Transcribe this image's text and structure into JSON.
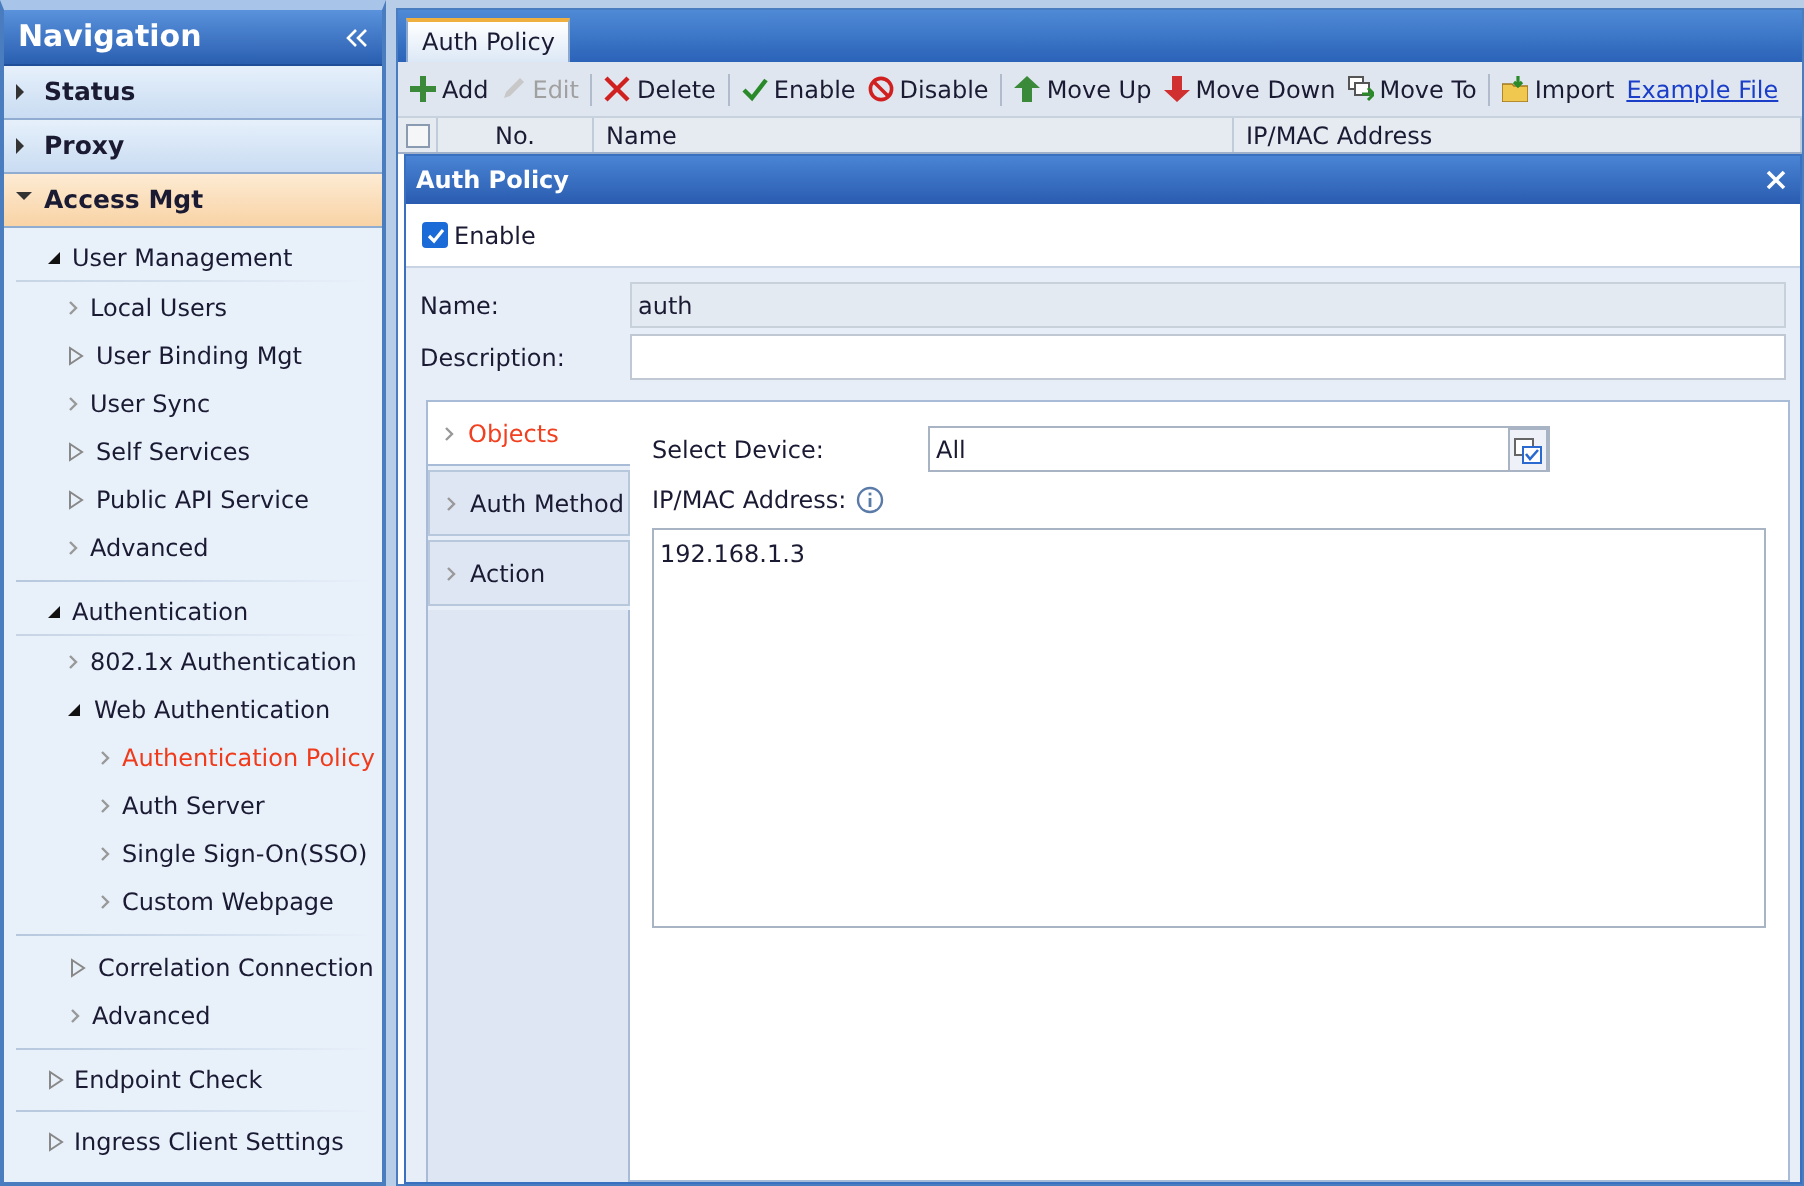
{
  "navigation": {
    "title": "Navigation",
    "sections": [
      {
        "label": "Status",
        "expanded": false
      },
      {
        "label": "Proxy",
        "expanded": false
      },
      {
        "label": "Access Mgt",
        "expanded": true,
        "groups": [
          {
            "label": "User Management",
            "expanded": true,
            "children": [
              {
                "label": "Local Users",
                "selected": false
              },
              {
                "label": "User Binding Mgt",
                "expanded": false,
                "selected": false
              },
              {
                "label": "User Sync",
                "selected": false
              },
              {
                "label": "Self Services",
                "expanded": false,
                "selected": false
              },
              {
                "label": "Public API Service",
                "expanded": false,
                "selected": false
              },
              {
                "label": "Advanced",
                "selected": false
              }
            ]
          },
          {
            "label": "Authentication",
            "expanded": true,
            "children": [
              {
                "label": "802.1x Authentication",
                "selected": false
              },
              {
                "label": "Web Authentication",
                "expanded": true,
                "selected": false,
                "children": [
                  {
                    "label": "Authentication Policy",
                    "selected": true
                  },
                  {
                    "label": "Auth Server",
                    "selected": false
                  },
                  {
                    "label": "Single Sign-On(SSO)",
                    "selected": false
                  },
                  {
                    "label": "Custom Webpage",
                    "selected": false
                  }
                ]
              }
            ]
          },
          {
            "children": [
              {
                "label": "Correlation Connection",
                "expanded": false,
                "selected": false
              },
              {
                "label": "Advanced",
                "selected": false
              }
            ]
          },
          {
            "label": "Endpoint Check",
            "expanded": false
          },
          {
            "label": "Ingress Client Settings",
            "expanded": false
          }
        ]
      }
    ]
  },
  "tabs": [
    {
      "label": "Auth Policy",
      "selected": true
    }
  ],
  "toolbar": [
    {
      "kind": "add",
      "label": "Add",
      "disabled": false
    },
    {
      "kind": "edit",
      "label": "Edit",
      "disabled": true
    },
    {
      "kind": "delete",
      "label": "Delete",
      "disabled": false
    },
    {
      "kind": "enable",
      "label": "Enable",
      "disabled": false
    },
    {
      "kind": "disable",
      "label": "Disable",
      "disabled": false
    },
    {
      "kind": "up",
      "label": "Move Up",
      "disabled": false
    },
    {
      "kind": "down",
      "label": "Move Down",
      "disabled": false
    },
    {
      "kind": "moveto",
      "label": "Move To",
      "disabled": false
    },
    {
      "kind": "import",
      "label": "Import",
      "disabled": false
    },
    {
      "kind": "link",
      "label": "Example File",
      "disabled": false
    }
  ],
  "table": {
    "header_checked": false,
    "columns": [
      "No.",
      "Name",
      "IP/MAC Address"
    ]
  },
  "dialog": {
    "title": "Auth Policy",
    "enable": {
      "label": "Enable",
      "checked": true
    },
    "name": {
      "label": "Name:",
      "value": "auth",
      "readonly": true
    },
    "description": {
      "label": "Description:",
      "readonly": false
    },
    "side_tabs": [
      {
        "label": "Objects",
        "selected": true
      },
      {
        "label": "Auth Method",
        "selected": false
      },
      {
        "label": "Action",
        "selected": false
      }
    ],
    "select_device": {
      "label": "Select Device:",
      "value": "All"
    },
    "ip_mac": {
      "label": "IP/MAC Address:",
      "value": "192.168.1.3"
    }
  }
}
